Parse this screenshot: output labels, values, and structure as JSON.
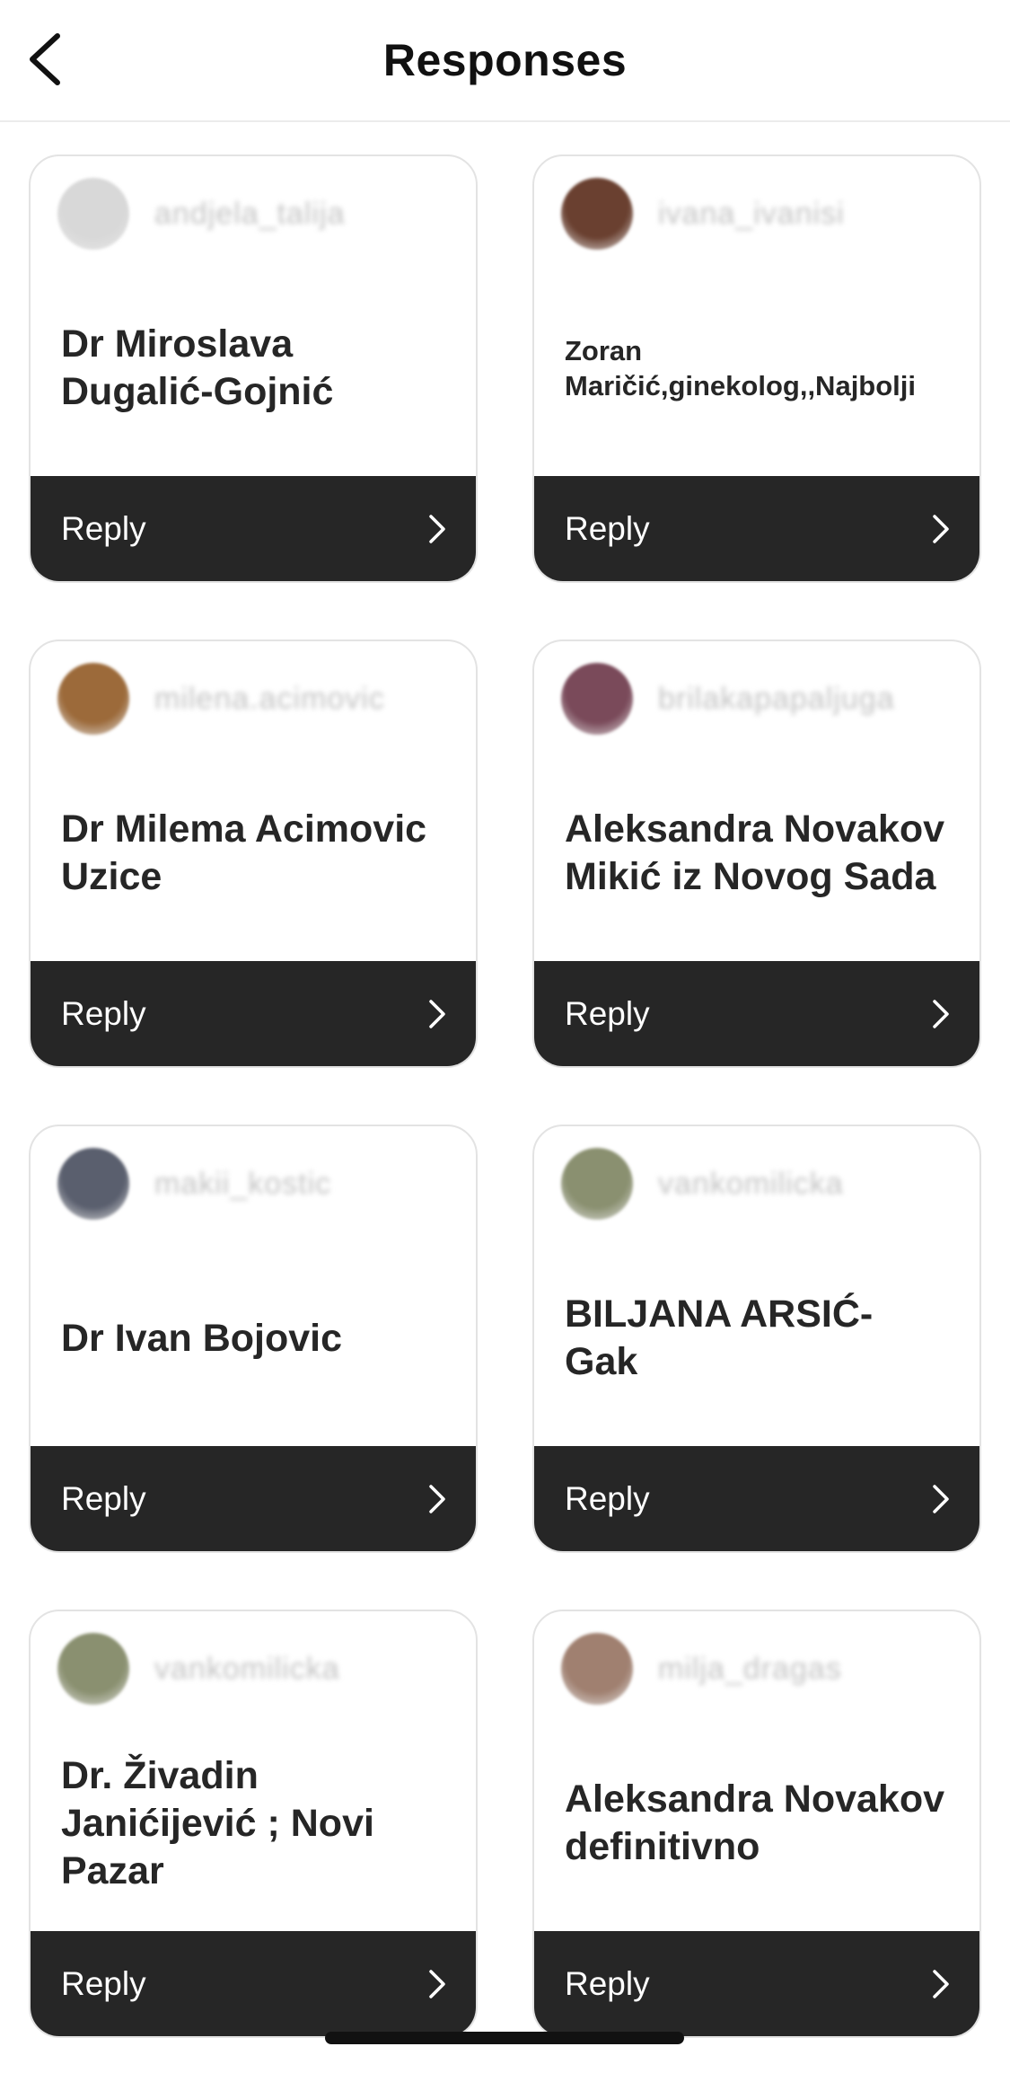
{
  "header": {
    "title": "Responses"
  },
  "icons": {
    "back": "chevron-left-icon",
    "reply": "chevron-right-icon"
  },
  "colors": {
    "reply_bar": "#262626",
    "card_border": "#e3e3e3",
    "text": "#262626"
  },
  "responses": [
    {
      "username": "andjela_talija",
      "text": "Dr Miroslava Dugalić-Gojnić",
      "reply_label": "Reply",
      "avatar_color": "#d8d8d8"
    },
    {
      "username": "ivana_ivanisi",
      "text": "Zoran Maričić,ginekolog,,Najbolji",
      "reply_label": "Reply",
      "avatar_color": "#6a4030"
    },
    {
      "username": "milena.acimovic",
      "text": "Dr Milema Acimovic Uzice",
      "reply_label": "Reply",
      "avatar_color": "#9c6a3a"
    },
    {
      "username": "brilakapapaljuga",
      "text": "Aleksandra Novakov Mikić iz Novog Sada",
      "reply_label": "Reply",
      "avatar_color": "#7a4a5a"
    },
    {
      "username": "makii_kostic",
      "text": "Dr Ivan Bojovic",
      "reply_label": "Reply",
      "avatar_color": "#5a5f6e"
    },
    {
      "username": "vankomilicka",
      "text": "BILJANA ARSIĆ- Gak",
      "reply_label": "Reply",
      "avatar_color": "#8a9070"
    },
    {
      "username": "vankomilicka",
      "text": "Dr. Živadin Janićijević ; Novi Pazar",
      "reply_label": "Reply",
      "avatar_color": "#8a9070"
    },
    {
      "username": "milja_dragas",
      "text": "Aleksandra Novakov definitivno",
      "reply_label": "Reply",
      "avatar_color": "#a08070"
    }
  ]
}
